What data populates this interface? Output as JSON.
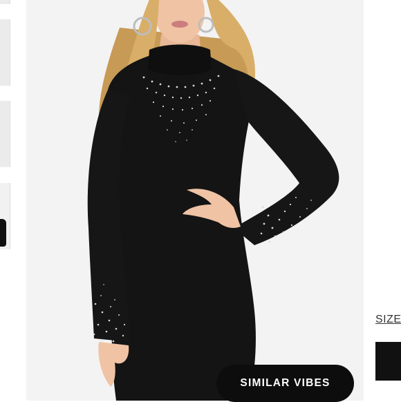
{
  "product_image": {
    "alt": "Model wearing black long-sleeve mock-neck mini dress with rhinestone embellishment"
  },
  "similar_vibes_button": {
    "label": "SIMILAR VIBES"
  },
  "size_section": {
    "label": "SIZE"
  },
  "colors": {
    "button_bg": "#0d0d0d",
    "button_text": "#ffffff",
    "image_bg": "#f3f3f3",
    "dress": "#141414"
  }
}
